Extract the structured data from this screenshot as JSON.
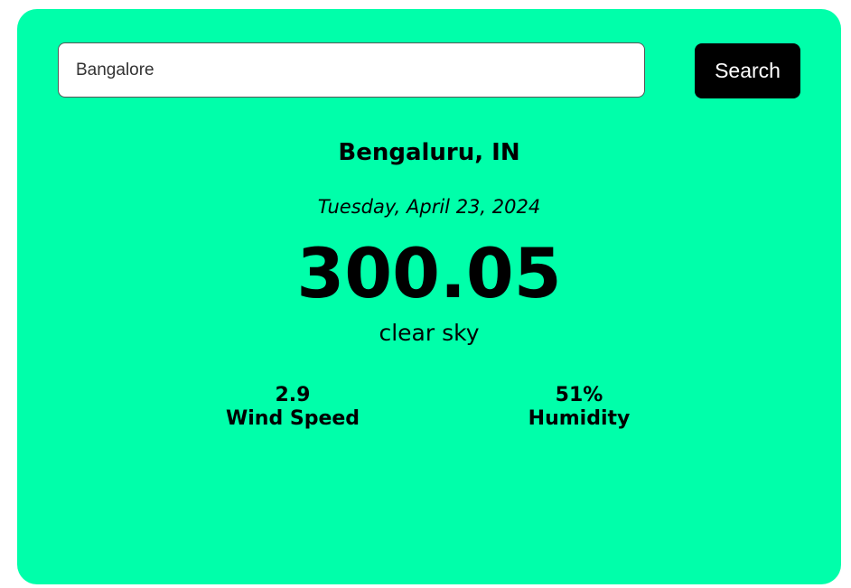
{
  "search": {
    "value": "Bangalore",
    "button_label": "Search"
  },
  "weather": {
    "location": "Bengaluru, IN",
    "date": "Tuesday, April 23, 2024",
    "temperature": "300.05",
    "description": "clear sky",
    "wind": {
      "value": "2.9",
      "label": "Wind Speed"
    },
    "humidity": {
      "value": "51%",
      "label": "Humidity"
    }
  },
  "colors": {
    "card_background": "#00ffaa",
    "button_background": "#000000",
    "button_text": "#ffffff"
  }
}
